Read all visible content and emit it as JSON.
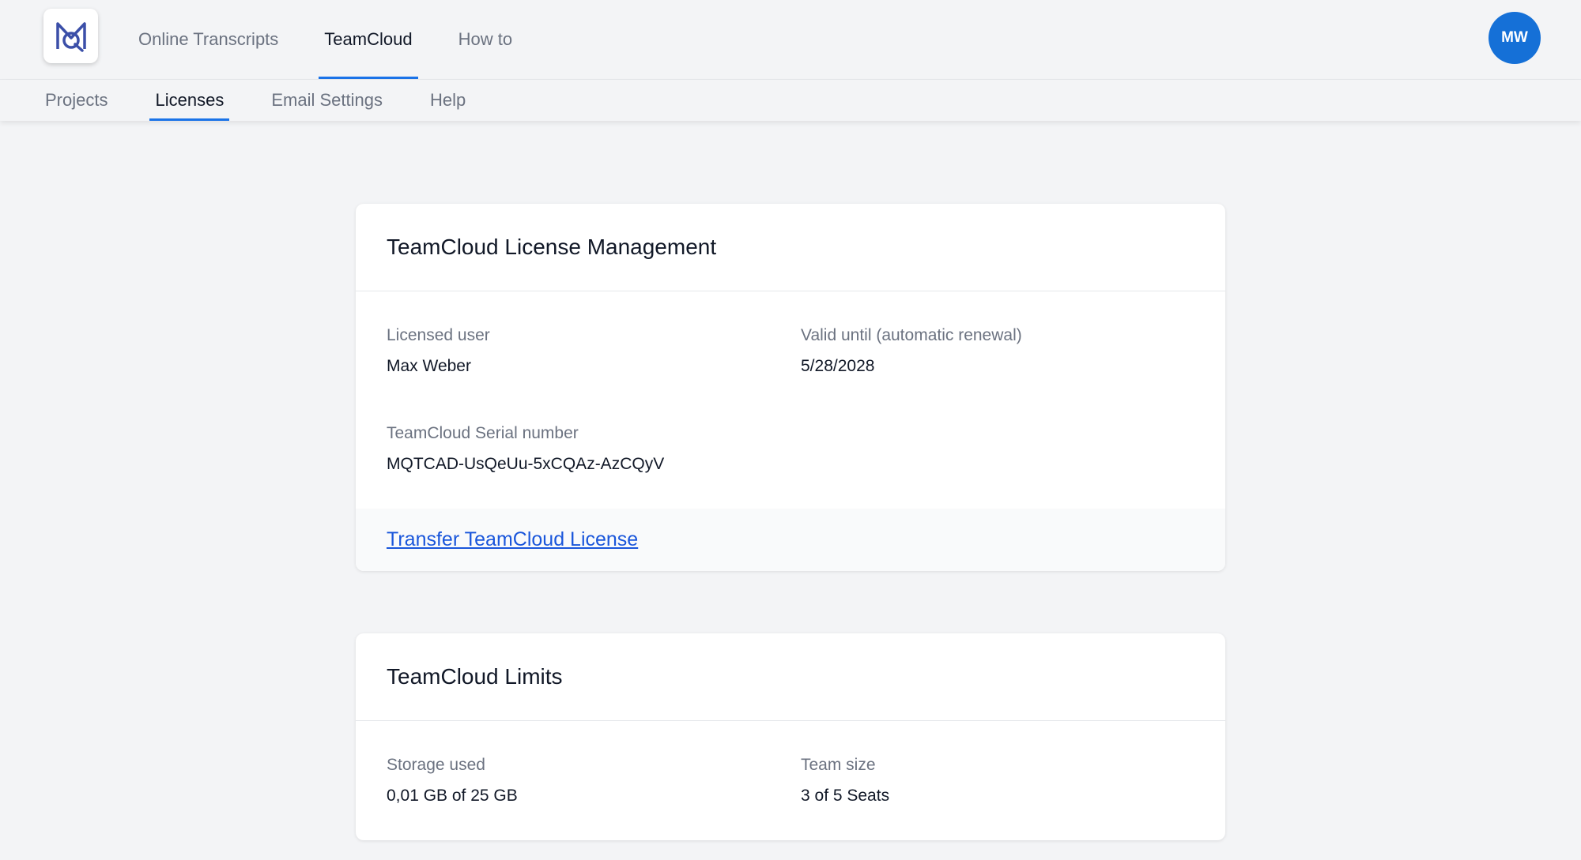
{
  "header": {
    "nav": [
      {
        "label": "Online Transcripts",
        "active": false
      },
      {
        "label": "TeamCloud",
        "active": true
      },
      {
        "label": "How to",
        "active": false
      }
    ],
    "avatar_initials": "MW"
  },
  "subnav": [
    {
      "label": "Projects",
      "active": false
    },
    {
      "label": "Licenses",
      "active": true
    },
    {
      "label": "Email Settings",
      "active": false
    },
    {
      "label": "Help",
      "active": false
    }
  ],
  "license_card": {
    "title": "TeamCloud License Management",
    "licensed_user_label": "Licensed user",
    "licensed_user_value": "Max Weber",
    "valid_until_label": "Valid until (automatic renewal)",
    "valid_until_value": "5/28/2028",
    "serial_label": "TeamCloud Serial number",
    "serial_value": "MQTCAD-UsQeUu-5xCQAz-AzCQyV",
    "transfer_link": "Transfer TeamCloud License"
  },
  "limits_card": {
    "title": "TeamCloud Limits",
    "storage_label": "Storage used",
    "storage_value": "0,01 GB of 25 GB",
    "team_label": "Team size",
    "team_value": "3 of 5 Seats"
  },
  "colors": {
    "accent": "#1a73e8",
    "avatar": "#1570d7",
    "link": "#1a56db",
    "logo": "#3b4fa8"
  },
  "icons": {
    "logo": "mq-logo-icon"
  }
}
